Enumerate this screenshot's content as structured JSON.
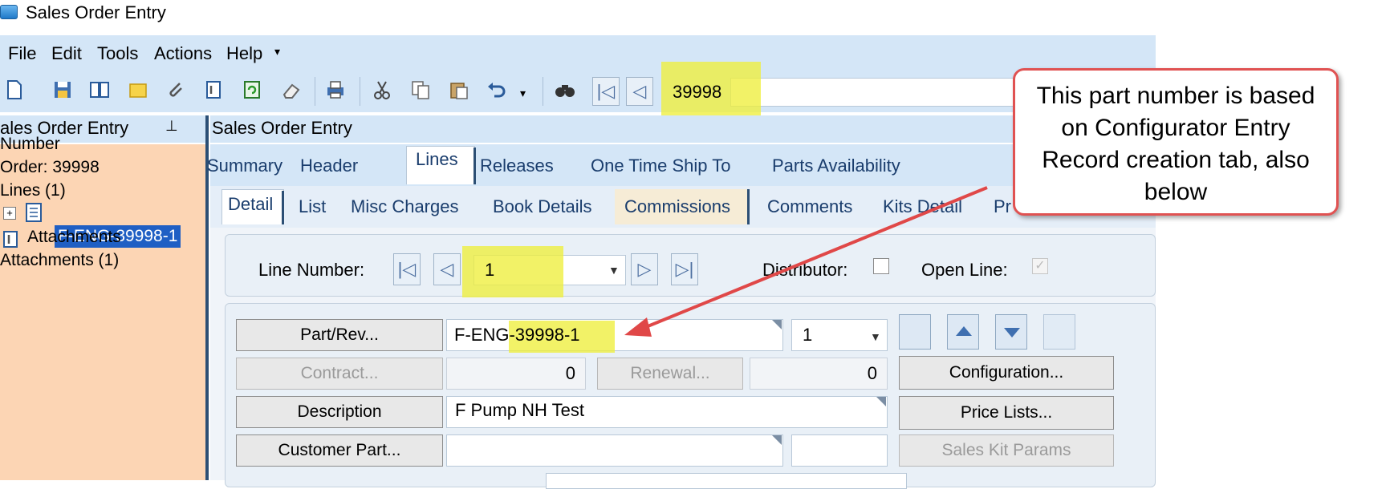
{
  "window": {
    "title": "Sales Order Entry",
    "icon": "app-window-icon"
  },
  "menu": {
    "items": [
      "File",
      "Edit",
      "Tools",
      "Actions",
      "Help"
    ],
    "overflow": "chevron-down-icon"
  },
  "toolbar": {
    "icons": [
      "new-icon",
      "save-icon",
      "notes-icon",
      "memo-icon",
      "attach-icon",
      "attachments-icon",
      "refresh-icon",
      "clear-icon",
      "print-icon",
      "cut-icon",
      "copy-icon",
      "paste-icon",
      "undo-icon",
      "search-icon",
      "first-record-icon",
      "previous-record-icon"
    ],
    "order_number": "39998"
  },
  "tree": {
    "header": "ales Order Entry",
    "pin_icon": "pin-icon",
    "items": [
      "Number",
      "Order: 39998",
      "Lines (1)",
      "F-ENG-39998-1",
      "Attachments",
      "Attachments (1)"
    ]
  },
  "main": {
    "header": "Sales Order Entry",
    "tabs": [
      "Summary",
      "Header",
      "Lines",
      "Releases",
      "One Time Ship To",
      "Parts Availability"
    ],
    "active_tab": "Lines",
    "subtabs": [
      "Detail",
      "List",
      "Misc Charges",
      "Book Details",
      "Commissions",
      "Comments",
      "Kits Detail",
      "Pr"
    ],
    "active_subtab": "Detail"
  },
  "line": {
    "line_number_label": "Line Number:",
    "line_number": "1",
    "distributor_label": "Distributor:",
    "open_line_label": "Open Line:"
  },
  "form": {
    "part_rev_button": "Part/Rev...",
    "part_number": "F-ENG-39998-1",
    "revision": "1",
    "contract_button": "Contract...",
    "contract_value": "0",
    "renewal_button": "Renewal...",
    "renewal_value": "0",
    "configuration_button": "Configuration...",
    "description_button": "Description",
    "description_value": "F Pump NH Test",
    "price_lists_button": "Price Lists...",
    "customer_part_button": "Customer Part...",
    "sales_kit_params_button": "Sales Kit Params"
  },
  "callout": {
    "text": "This part number is based on Configurator Entry Record creation tab, also below"
  },
  "colors": {
    "highlight": "#EEEE3C",
    "callout_border": "#E05252",
    "arrow": "#E04848",
    "selection": "#1F5FC4",
    "tree_bg": "#FCD5B4",
    "chrome": "#D4E6F7"
  }
}
